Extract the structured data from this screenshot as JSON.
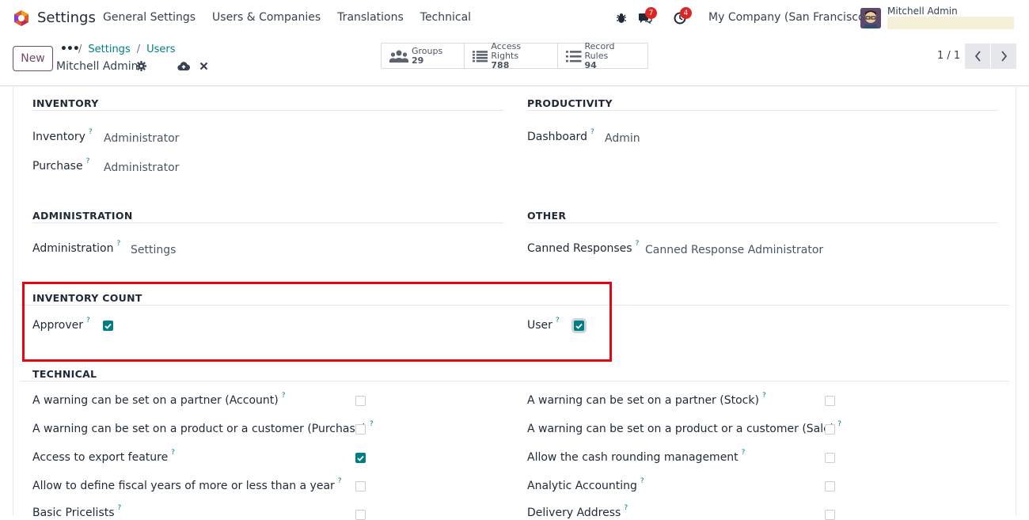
{
  "app": {
    "name": "Settings"
  },
  "menu": [
    "General Settings",
    "Users & Companies",
    "Translations",
    "Technical"
  ],
  "systray": {
    "messages_count": "7",
    "activities_count": "4",
    "company": "My Company (San Francisco)",
    "user": "Mitchell Admin"
  },
  "control": {
    "new_label": "New",
    "breadcrumb": [
      "Settings",
      "Users"
    ],
    "record_name": "Mitchell Admin",
    "smart_buttons": [
      {
        "label": "Groups",
        "value": "29",
        "icon": "users-icon"
      },
      {
        "label": "Access Rights",
        "value": "788",
        "icon": "list-icon"
      },
      {
        "label": "Record Rules",
        "value": "94",
        "icon": "list-icon"
      }
    ],
    "pager": "1 / 1"
  },
  "sections": {
    "inventory": {
      "title": "INVENTORY",
      "fields": [
        {
          "label": "Inventory",
          "value": "Administrator"
        },
        {
          "label": "Purchase",
          "value": "Administrator"
        }
      ]
    },
    "productivity": {
      "title": "PRODUCTIVITY",
      "fields": [
        {
          "label": "Dashboard",
          "value": "Admin"
        }
      ]
    },
    "administration": {
      "title": "ADMINISTRATION",
      "fields": [
        {
          "label": "Administration",
          "value": "Settings"
        }
      ]
    },
    "other": {
      "title": "OTHER",
      "fields": [
        {
          "label": "Canned Responses",
          "value": "Canned Response Administrator"
        }
      ]
    },
    "inventory_count": {
      "title": "INVENTORY COUNT",
      "fields": [
        {
          "label": "Approver",
          "checked": true
        },
        {
          "label": "User",
          "checked": true
        }
      ]
    },
    "technical": {
      "title": "TECHNICAL",
      "left": [
        {
          "label": "A warning can be set on a partner (Account)",
          "checked": false
        },
        {
          "label": "A warning can be set on a product or a customer (Purchase)",
          "checked": false
        },
        {
          "label": "Access to export feature",
          "checked": true
        },
        {
          "label": "Allow to define fiscal years of more or less than a year",
          "checked": false
        },
        {
          "label": "Basic Pricelists",
          "checked": false
        }
      ],
      "right": [
        {
          "label": "A warning can be set on a partner (Stock)",
          "checked": false
        },
        {
          "label": "A warning can be set on a product or a customer (Sale)",
          "checked": false
        },
        {
          "label": "Allow the cash rounding management",
          "checked": false
        },
        {
          "label": "Analytic Accounting",
          "checked": false
        },
        {
          "label": "Delivery Address",
          "checked": false
        }
      ]
    }
  },
  "help_mark": "?"
}
